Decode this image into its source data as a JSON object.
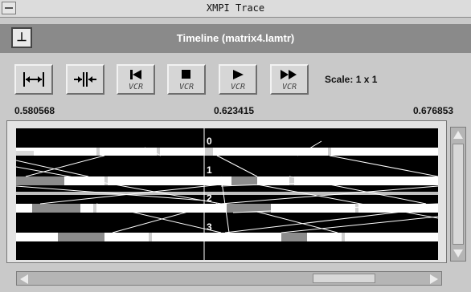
{
  "window": {
    "title": "XMPI Trace"
  },
  "header": {
    "title": "Timeline  (matrix4.lamtr)",
    "pin_icon": "pin-icon",
    "pin_glyph": "⊥"
  },
  "toolbar": {
    "buttons": [
      {
        "name": "zoom-out-button",
        "icon": "expand-arrows-icon",
        "caption": ""
      },
      {
        "name": "zoom-in-button",
        "icon": "contract-arrows-icon",
        "caption": ""
      },
      {
        "name": "vcr-rewind-button",
        "icon": "rewind-icon",
        "caption": "VCR"
      },
      {
        "name": "vcr-stop-button",
        "icon": "stop-icon",
        "caption": "VCR"
      },
      {
        "name": "vcr-play-button",
        "icon": "play-icon",
        "caption": "VCR"
      },
      {
        "name": "vcr-fastforward-button",
        "icon": "fast-forward-icon",
        "caption": "VCR"
      }
    ],
    "scale_label": "Scale: 1 x 1"
  },
  "times": {
    "start": "0.580568",
    "middle": "0.623415",
    "end": "0.676853"
  },
  "timeline": {
    "process_labels": [
      "0",
      "1",
      "2",
      "3"
    ],
    "colors": {
      "background": "#000000",
      "running": "#ffffff",
      "blocked": "#8c8c8c",
      "message": "#ffffff"
    }
  }
}
